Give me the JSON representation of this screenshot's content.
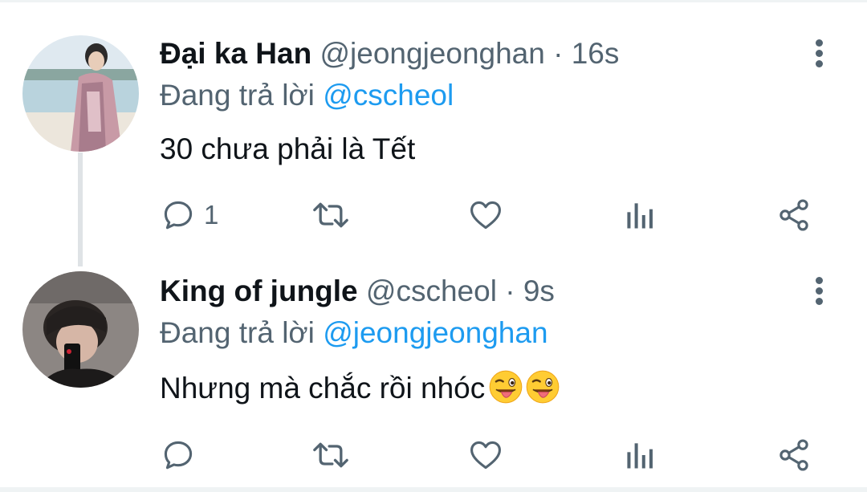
{
  "tweets": [
    {
      "display_name": "Đại ka Han",
      "handle": "@jeongjeonghan",
      "separator": "·",
      "time": "16s",
      "reply_prefix": "Đang trả lời",
      "reply_to": "@cscheol",
      "text": "30 chưa phải là Tết",
      "reply_count": "1"
    },
    {
      "display_name": "King of jungle",
      "handle": "@cscheol",
      "separator": "·",
      "time": "9s",
      "reply_prefix": "Đang trả lời",
      "reply_to": "@jeongjeonghan",
      "text": "Nhưng mà chắc rồi nhóc",
      "emojis": [
        "winking-face-with-tongue",
        "winking-face-with-tongue"
      ],
      "reply_count": ""
    }
  ],
  "colors": {
    "text": "#0f1419",
    "secondary": "#536471",
    "link": "#1d9bf0",
    "divider": "#eff3f4",
    "thread_line": "#dfe3e6"
  },
  "icons": {
    "reply": "reply-bubble-icon",
    "retweet": "retweet-icon",
    "like": "heart-icon",
    "stats": "bar-chart-icon",
    "share": "share-icon",
    "more": "more-vertical-icon"
  }
}
